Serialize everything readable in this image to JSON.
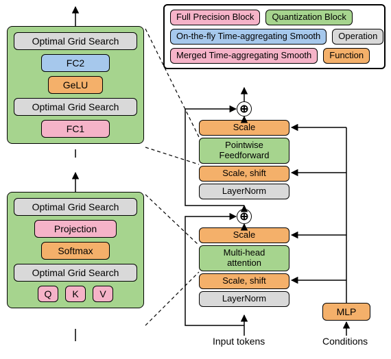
{
  "legend": {
    "full_precision": "Full Precision Block",
    "quantization": "Quantization Block",
    "onfly_smooth": "On-the-fly Time-aggregating Smooth",
    "operation": "Operation",
    "merged_smooth": "Merged Time-aggregating Smooth",
    "function": "Function"
  },
  "top_panel": {
    "ogs_top": "Optimal Grid Search",
    "fc2": "FC2",
    "gelu": "GeLU",
    "ogs_bottom": "Optimal Grid Search",
    "fc1": "FC1"
  },
  "bottom_panel": {
    "ogs_top": "Optimal Grid Search",
    "projection": "Projection",
    "softmax": "Softmax",
    "ogs_bottom": "Optimal Grid Search",
    "q": "Q",
    "k": "K",
    "v": "V"
  },
  "right_upper": {
    "scale": "Scale",
    "pointwise_ff": "Pointwise\nFeedforward",
    "scale_shift": "Scale, shift",
    "layernorm": "LayerNorm"
  },
  "right_lower": {
    "scale": "Scale",
    "mha": "Multi-head\nattention",
    "scale_shift": "Scale, shift",
    "layernorm": "LayerNorm"
  },
  "mlp": "MLP",
  "caption_tokens": "Input tokens",
  "caption_conditions": "Conditions",
  "chart_data": {
    "type": "diagram",
    "title": "",
    "components": {
      "top_feedforward_detail_panel": [
        "Optimal Grid Search",
        "FC2",
        "GeLU",
        "Optimal Grid Search",
        "FC1"
      ],
      "bottom_attention_detail_panel": [
        "Optimal Grid Search",
        "Projection",
        "Softmax",
        "Optimal Grid Search",
        [
          "Q",
          "K",
          "V"
        ]
      ],
      "right_column_top_to_bottom": [
        "⊕",
        "Scale",
        "Pointwise Feedforward",
        "Scale, shift",
        "LayerNorm",
        "⊕",
        "Scale",
        "Multi-head attention",
        "Scale, shift",
        "LayerNorm"
      ],
      "side_block": "MLP",
      "inputs": [
        "Input tokens",
        "Conditions"
      ]
    },
    "color_mapping": {
      "Full Precision Block": "#f5b3c8",
      "Quantization Block": "#a6d48e",
      "On-the-fly Time-aggregating Smooth": "#a6c8ec",
      "Operation": "#d9d9d9",
      "Merged Time-aggregating Smooth": "#f5b3c8",
      "Function": "#f4b06a"
    },
    "connections": [
      "dashed: top_panel -> Pointwise Feedforward (expansion)",
      "dashed: bottom_panel -> Multi-head attention (expansion)",
      "residual skip around upper Scale..LayerNorm via ⊕",
      "residual skip around lower Scale..LayerNorm via ⊕",
      "MLP feeds Scale and Scale,shift blocks (both upper and lower) from Conditions",
      "Input tokens -> lower LayerNorm",
      "vertical arrows through both detail panels"
    ]
  }
}
